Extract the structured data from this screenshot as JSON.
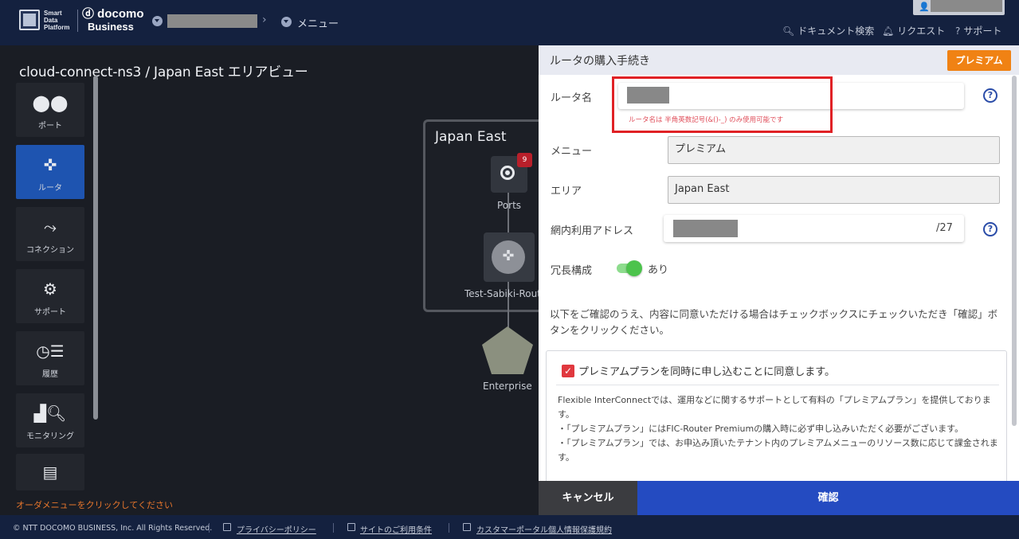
{
  "header": {
    "brand_sdp": "Smart Data Platform",
    "brand_docomo": "docomo",
    "brand_business": "Business",
    "breadcrumb_menu": "メニュー",
    "links": [
      "ドキュメント検索",
      "リクエスト",
      "サポート"
    ]
  },
  "left": {
    "area_title": "cloud-connect-ns3 / Japan East エリアビュー",
    "sidebar": [
      {
        "label": "ポート",
        "icon": "port-icon"
      },
      {
        "label": "ルータ",
        "icon": "router-icon",
        "active": true
      },
      {
        "label": "コネクション",
        "icon": "connection-icon"
      },
      {
        "label": "サポート",
        "icon": "support-icon"
      },
      {
        "label": "履歴",
        "icon": "history-icon"
      },
      {
        "label": "モニタリング",
        "icon": "monitoring-icon"
      },
      {
        "label": "",
        "icon": "order-menu-icon"
      }
    ],
    "order_note": "オーダメニューをクリックしてください"
  },
  "diagram": {
    "region": "Japan East",
    "ports_label": "Ports",
    "ports_badge": "9",
    "router_label": "Test-Sabiki-Router",
    "enterprise_label": "Enterprise"
  },
  "panel": {
    "title": "ルータの購入手続き",
    "premium_label": "プレミアム",
    "router_name_label": "ルータ名",
    "router_name_error": "ルータ名は 半角英数記号(&()-_) のみ使用可能です",
    "menu_label": "メニュー",
    "menu_value": "プレミアム",
    "area_label": "エリア",
    "area_value": "Japan East",
    "address_label": "網内利用アドレス",
    "address_suffix": "/27",
    "redundancy_label": "冗長構成",
    "redundancy_value": "あり",
    "redundancy_on": true,
    "notice": "以下をご確認のうえ、内容に同意いただける場合はチェックボックスにチェックいただき「確認」ボタンをクリックください。",
    "consent_label": "プレミアムプランを同時に申し込むことに同意します。",
    "consent_checked": true,
    "consent_body": [
      "Flexible InterConnectでは、運用などに関するサポートとして有料の「プレミアムプラン」を提供しております。",
      "・「プレミアムプラン」にはFIC-Router Premiumの購入時に必ず申し込みいただく必要がございます。",
      "・「プレミアムプラン」では、お申込み頂いたテナント内のプレミアムメニューのリソース数に応じて課金されます。"
    ],
    "cancel_label": "キャンセル",
    "confirm_label": "確認"
  },
  "footer": {
    "copyright": "© NTT DOCOMO BUSINESS, Inc. All Rights Reserved.",
    "links": [
      "プライバシーポリシー",
      "サイトのご利用条件",
      "カスタマーポータル個人情報保護規約"
    ]
  },
  "colors": {
    "header_bg": "#14213f",
    "accent_blue": "#244bc1",
    "premium_orange": "#f08214",
    "error_red": "#e02125",
    "toggle_green": "#4cc34c"
  }
}
